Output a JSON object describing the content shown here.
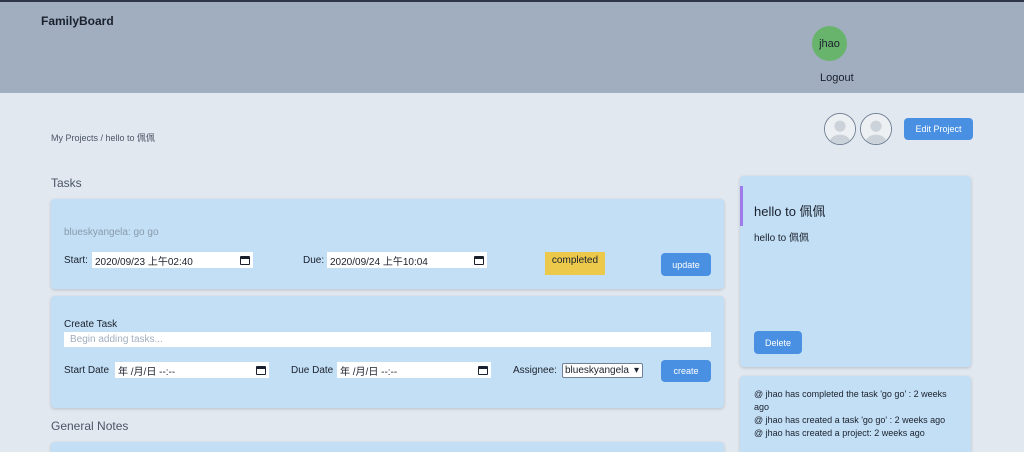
{
  "header": {
    "brand": "FamilyBoard",
    "user_initials": "jhao",
    "logout_label": "Logout"
  },
  "breadcrumb": "My Projects / hello to 佩佩",
  "project_actions": {
    "edit_label": "Edit Project"
  },
  "tasks_section": {
    "title": "Tasks",
    "task": {
      "text": "blueskyangela: go go",
      "start_label": "Start:",
      "start_value": "2020/09/23 上午02:40",
      "due_label": "Due:",
      "due_value": "2020/09/24 上午10:04",
      "status": "completed",
      "update_label": "update"
    },
    "create": {
      "title": "Create Task",
      "placeholder": "Begin adding tasks...",
      "start_date_label": "Start Date",
      "start_date_value": "年 /月/日 --:--",
      "due_date_label": "Due Date",
      "due_date_value": "年 /月/日 --:--",
      "assignee_label": "Assignee:",
      "assignee_value": "blueskyangela",
      "create_label": "create"
    }
  },
  "notes_section": {
    "title": "General Notes"
  },
  "project": {
    "title": "hello to 佩佩",
    "description": "hello to 佩佩",
    "delete_label": "Delete"
  },
  "activity": [
    "@ jhao has completed the task 'go go' : 2 weeks ago",
    "@ jhao has created a task 'go go' : 2 weeks ago",
    "@ jhao has created a project: 2 weeks ago"
  ],
  "colors": {
    "accent": "#4a90e2",
    "header_bg": "#a0aec0",
    "card_bg": "#c3dff5",
    "status_completed": "#ecc94b",
    "avatar": "#68b46c"
  }
}
